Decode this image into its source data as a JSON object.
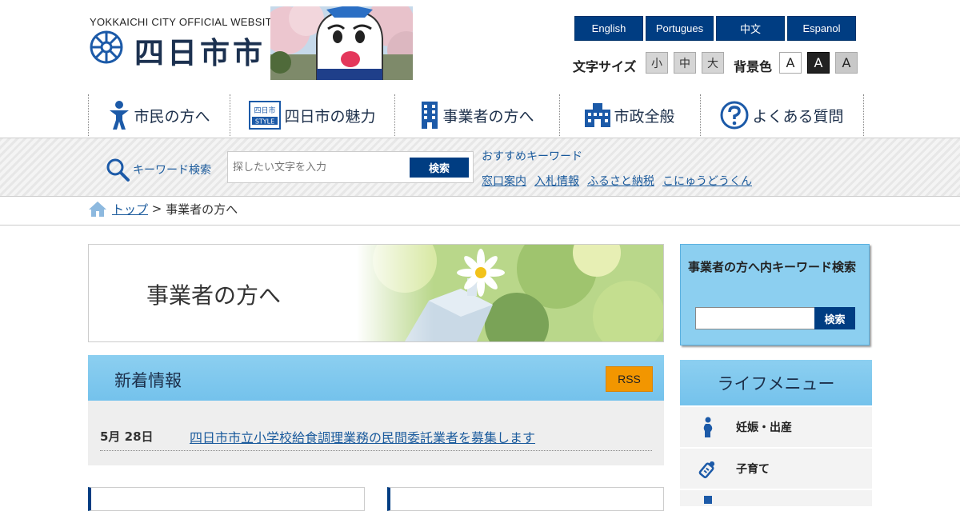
{
  "header": {
    "site_subtitle": "YOKKAICHI CITY OFFICIAL WEBSITE",
    "site_title": "四日市市",
    "languages": [
      "English",
      "Portugues",
      "中文",
      "Espanol"
    ],
    "font_size_label": "文字サイズ",
    "font_sizes": [
      "小",
      "中",
      "大"
    ],
    "bg_color_label": "背景色",
    "bg_colors": [
      "A",
      "A",
      "A"
    ]
  },
  "nav": {
    "items": [
      {
        "label": "市民の方へ",
        "icon": "person-icon"
      },
      {
        "label": "四日市の魅力",
        "icon": "yokkaichi-style-icon"
      },
      {
        "label": "事業者の方へ",
        "icon": "building-icon"
      },
      {
        "label": "市政全般",
        "icon": "city-hall-icon"
      },
      {
        "label": "よくある質問",
        "icon": "question-icon"
      }
    ]
  },
  "search": {
    "label": "キーワード検索",
    "placeholder": "探したい文字を入力",
    "button": "検索",
    "recommended_title": "おすすめキーワード",
    "recommended": [
      "窓口案内",
      "入札情報",
      "ふるさと納税",
      "こにゅうどうくん"
    ]
  },
  "breadcrumb": {
    "top": "トップ",
    "separator": " > ",
    "current": "事業者の方へ"
  },
  "main": {
    "page_title": "事業者の方へ",
    "news": {
      "title": "新着情報",
      "rss": "RSS",
      "items": [
        {
          "date": "5月 28日",
          "text": "四日市市立小学校給食調理業務の民間委託業者を募集します"
        }
      ]
    }
  },
  "sidebar": {
    "search_title": "事業者の方へ内キーワード検索",
    "search_button": "検索",
    "life_menu_title": "ライフメニュー",
    "life_items": [
      {
        "label": "妊娠・出産",
        "icon": "pregnancy-icon"
      },
      {
        "label": "子育て",
        "icon": "baby-bottle-icon"
      }
    ]
  },
  "colors": {
    "brand_navy": "#003d82",
    "accent_blue": "#8ccff0",
    "rss_orange": "#f29600",
    "link": "#1a5a9c"
  }
}
